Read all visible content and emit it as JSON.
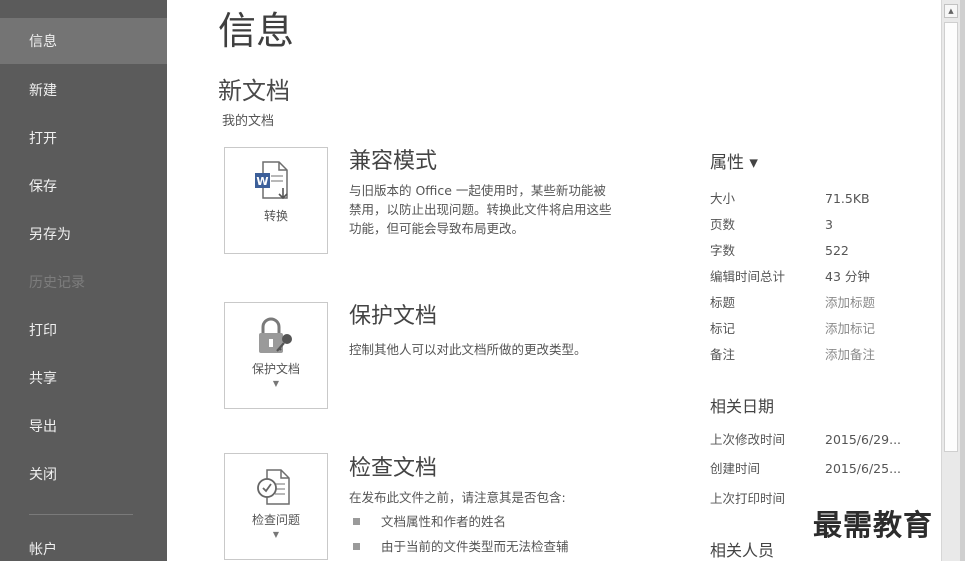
{
  "sidebar": {
    "items": [
      {
        "label": "信息",
        "active": true
      },
      {
        "label": "新建"
      },
      {
        "label": "打开"
      },
      {
        "label": "保存"
      },
      {
        "label": "另存为"
      },
      {
        "label": "历史记录",
        "disabled": true
      },
      {
        "label": "打印"
      },
      {
        "label": "共享"
      },
      {
        "label": "导出"
      },
      {
        "label": "关闭"
      },
      {
        "label": "帐户"
      }
    ]
  },
  "main": {
    "title": "信息",
    "doc_name": "新文档",
    "doc_path": "我的文档",
    "sections": [
      {
        "button_label": "转换",
        "icon": "word-convert-icon",
        "title": "兼容模式",
        "desc": "与旧版本的 Office 一起使用时，某些新功能被禁用，以防止出现问题。转换此文件将启用这些功能，但可能会导致布局更改。"
      },
      {
        "button_label": "保护文档",
        "icon": "lock-key-icon",
        "title": "保护文档",
        "desc": "控制其他人可以对此文档所做的更改类型。"
      },
      {
        "button_label": "检查问题",
        "icon": "inspect-document-icon",
        "title": "检查文档",
        "desc": "在发布此文件之前，请注意其是否包含:",
        "bullets": [
          "文档属性和作者的姓名",
          "由于当前的文件类型而无法检查辅"
        ]
      }
    ]
  },
  "properties": {
    "title": "属性 ▾",
    "rows": [
      {
        "label": "大小",
        "value": "71.5KB"
      },
      {
        "label": "页数",
        "value": "3"
      },
      {
        "label": "字数",
        "value": "522"
      },
      {
        "label": "编辑时间总计",
        "value": "43 分钟"
      },
      {
        "label": "标题",
        "value": "添加标题",
        "placeholder": true
      },
      {
        "label": "标记",
        "value": "添加标记",
        "placeholder": true
      },
      {
        "label": "备注",
        "value": "添加备注",
        "placeholder": true
      }
    ],
    "dates_heading": "相关日期",
    "dates": [
      {
        "label": "上次修改时间",
        "value": "2015/6/29..."
      },
      {
        "label": "创建时间",
        "value": "2015/6/25..."
      },
      {
        "label": "上次打印时间",
        "value": ""
      }
    ],
    "people_heading": "相关人员"
  },
  "watermark": "最需教育",
  "colors": {
    "sidebar_bg": "#5b5b5b",
    "sidebar_active": "#747474",
    "word_blue": "#3c5f99"
  }
}
